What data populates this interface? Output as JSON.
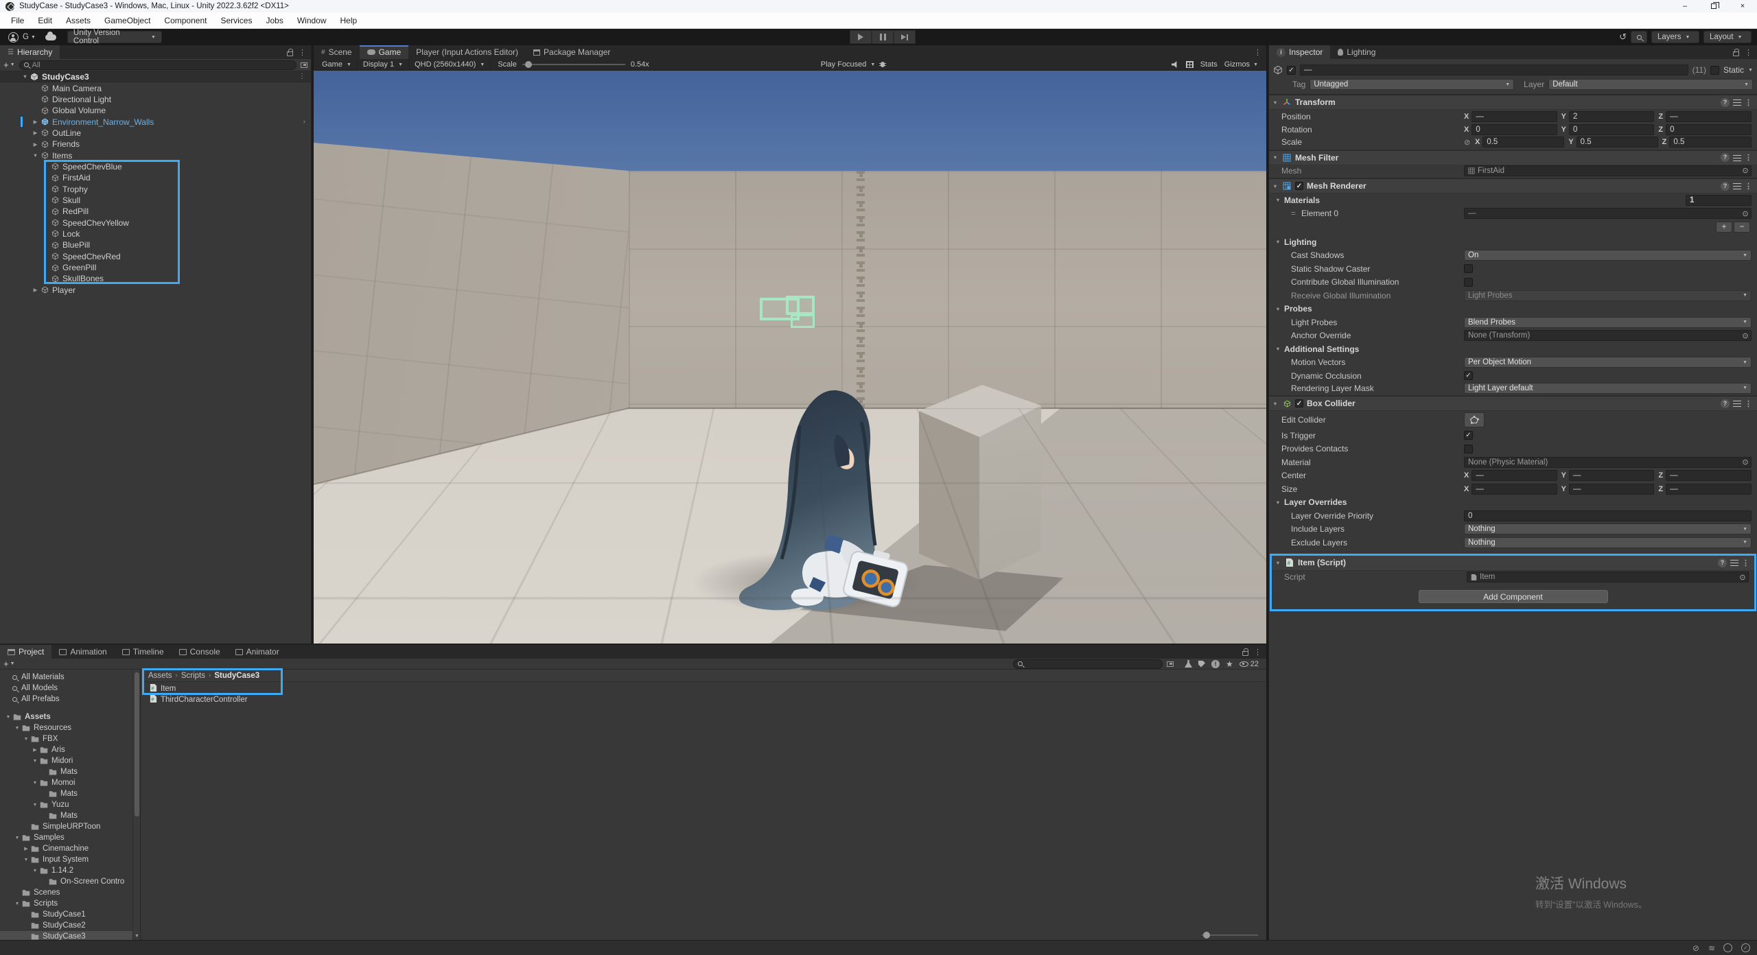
{
  "accents": {
    "highlight_blue": "#3fa9f5",
    "prefab_blue": "#6eb2e6",
    "tab_focus_blue": "#4f7fd0",
    "collider_green": "#8ee04a"
  },
  "title_bar": {
    "title": "StudyCase - StudyCase3 - Windows, Mac, Linux - Unity 2022.3.62f2 <DX11>"
  },
  "menu_bar": {
    "items": [
      "File",
      "Edit",
      "Assets",
      "GameObject",
      "Component",
      "Services",
      "Jobs",
      "Window",
      "Help"
    ]
  },
  "toolbar": {
    "account_label": "G",
    "version_control_label": "Unity Version Control",
    "layers_label": "Layers",
    "layout_label": "Layout"
  },
  "hierarchy": {
    "tab": "Hierarchy",
    "search_placeholder": "All",
    "rows": [
      {
        "label": "StudyCase3",
        "depth": 0,
        "icon": "scene",
        "arrow": "open",
        "header": true,
        "kebab": true
      },
      {
        "label": "Main Camera",
        "depth": 1,
        "icon": "cube"
      },
      {
        "label": "Directional Light",
        "depth": 1,
        "icon": "cube"
      },
      {
        "label": "Global Volume",
        "depth": 1,
        "icon": "cube"
      },
      {
        "label": "Environment_Narrow_Walls",
        "depth": 1,
        "icon": "prefab",
        "arrow": "closed",
        "prefab": true,
        "chevron": true,
        "bar": true
      },
      {
        "label": "OutLine",
        "depth": 1,
        "icon": "cube",
        "arrow": "closed"
      },
      {
        "label": "Friends",
        "depth": 1,
        "icon": "cube",
        "arrow": "closed"
      },
      {
        "label": "Items",
        "depth": 1,
        "icon": "cube",
        "arrow": "open"
      },
      {
        "label": "SpeedChevBlue",
        "depth": 2,
        "icon": "cube"
      },
      {
        "label": "FirstAid",
        "depth": 2,
        "icon": "cube"
      },
      {
        "label": "Trophy",
        "depth": 2,
        "icon": "cube"
      },
      {
        "label": "Skull",
        "depth": 2,
        "icon": "cube"
      },
      {
        "label": "RedPill",
        "depth": 2,
        "icon": "cube"
      },
      {
        "label": "SpeedChevYellow",
        "depth": 2,
        "icon": "cube"
      },
      {
        "label": "Lock",
        "depth": 2,
        "icon": "cube"
      },
      {
        "label": "BluePill",
        "depth": 2,
        "icon": "cube"
      },
      {
        "label": "SpeedChevRed",
        "depth": 2,
        "icon": "cube"
      },
      {
        "label": "GreenPill",
        "depth": 2,
        "icon": "cube"
      },
      {
        "label": "SkullBones",
        "depth": 2,
        "icon": "cube"
      },
      {
        "label": "Player",
        "depth": 1,
        "icon": "cube",
        "arrow": "closed"
      }
    ]
  },
  "center_tabs": {
    "scene": "Scene",
    "game": "Game",
    "player": "Player (Input Actions Editor)",
    "package": "Package Manager"
  },
  "game_toolbar": {
    "mode": "Game",
    "display": "Display 1",
    "resolution": "QHD (2560x1440)",
    "scale_label": "Scale",
    "scale_value": "0.54x",
    "play_focused": "Play Focused",
    "stats_label": "Stats",
    "gizmos_label": "Gizmos"
  },
  "inspector": {
    "tabs": [
      "Inspector",
      "Lighting"
    ],
    "header": {
      "name": "—",
      "count": "(11)",
      "static_label": "Static",
      "tag_label": "Tag",
      "tag_value": "Untagged",
      "layer_label": "Layer",
      "layer_value": "Default"
    },
    "transform": {
      "title": "Transform",
      "position": {
        "label": "Position",
        "x": "—",
        "y": "2",
        "z": "—"
      },
      "rotation": {
        "label": "Rotation",
        "x": "0",
        "y": "0",
        "z": "0"
      },
      "scale": {
        "label": "Scale",
        "x": "0.5",
        "y": "0.5",
        "z": "0.5"
      }
    },
    "mesh_filter": {
      "title": "Mesh Filter",
      "mesh_label": "Mesh",
      "mesh_value": "FirstAid"
    },
    "mesh_renderer": {
      "title": "Mesh Renderer",
      "materials_label": "Materials",
      "materials_count": "1",
      "element0_label": "Element 0",
      "element0_value": "—",
      "lighting_title": "Lighting",
      "cast_shadows_label": "Cast Shadows",
      "cast_shadows_value": "On",
      "static_shadow_label": "Static Shadow Caster",
      "contribute_gi_label": "Contribute Global Illumination",
      "receive_gi_label": "Receive Global Illumination",
      "receive_gi_value": "Light Probes",
      "probes_title": "Probes",
      "light_probes_label": "Light Probes",
      "light_probes_value": "Blend Probes",
      "anchor_label": "Anchor Override",
      "anchor_value": "None (Transform)",
      "additional_title": "Additional Settings",
      "motion_label": "Motion Vectors",
      "motion_value": "Per Object Motion",
      "occlusion_label": "Dynamic Occlusion",
      "mask_label": "Rendering Layer Mask",
      "mask_value": "Light Layer default"
    },
    "box_collider": {
      "title": "Box Collider",
      "edit_label": "Edit Collider",
      "trigger_label": "Is Trigger",
      "contacts_label": "Provides Contacts",
      "material_label": "Material",
      "material_value": "None (Physic Material)",
      "center_label": "Center",
      "center": {
        "x": "—",
        "y": "—",
        "z": "—"
      },
      "size_label": "Size",
      "size": {
        "x": "—",
        "y": "—",
        "z": "—"
      },
      "overrides_title": "Layer Overrides",
      "priority_label": "Layer Override Priority",
      "priority_value": "0",
      "include_label": "Include Layers",
      "include_value": "Nothing",
      "exclude_label": "Exclude Layers",
      "exclude_value": "Nothing"
    },
    "item_script": {
      "title": "Item (Script)",
      "script_label": "Script",
      "script_value": "Item"
    },
    "add_component_label": "Add Component"
  },
  "project": {
    "tabs": [
      "Project",
      "Animation",
      "Timeline",
      "Console",
      "Animator"
    ],
    "favorites": [
      "All Materials",
      "All Models",
      "All Prefabs"
    ],
    "tree": [
      {
        "label": "Assets",
        "depth": 0,
        "arrow": "open",
        "bold": true
      },
      {
        "label": "Resources",
        "depth": 1,
        "arrow": "open"
      },
      {
        "label": "FBX",
        "depth": 2,
        "arrow": "open"
      },
      {
        "label": "Aris",
        "depth": 3,
        "arrow": "closed"
      },
      {
        "label": "Midori",
        "depth": 3,
        "arrow": "open"
      },
      {
        "label": "Mats",
        "depth": 4
      },
      {
        "label": "Momoi",
        "depth": 3,
        "arrow": "open"
      },
      {
        "label": "Mats",
        "depth": 4
      },
      {
        "label": "Yuzu",
        "depth": 3,
        "arrow": "open"
      },
      {
        "label": "Mats",
        "depth": 4
      },
      {
        "label": "SimpleURPToon",
        "depth": 2
      },
      {
        "label": "Samples",
        "depth": 1,
        "arrow": "open"
      },
      {
        "label": "Cinemachine",
        "depth": 2,
        "arrow": "closed"
      },
      {
        "label": "Input System",
        "depth": 2,
        "arrow": "open"
      },
      {
        "label": "1.14.2",
        "depth": 3,
        "arrow": "open"
      },
      {
        "label": "On-Screen Contro",
        "depth": 4
      },
      {
        "label": "Scenes",
        "depth": 1
      },
      {
        "label": "Scripts",
        "depth": 1,
        "arrow": "open"
      },
      {
        "label": "StudyCase1",
        "depth": 2
      },
      {
        "label": "StudyCase2",
        "depth": 2
      },
      {
        "label": "StudyCase3",
        "depth": 2,
        "selected": true
      }
    ],
    "breadcrumb": [
      "Assets",
      "Scripts",
      "StudyCase3"
    ],
    "files": [
      {
        "label": "Item"
      },
      {
        "label": "ThirdCharacterController"
      }
    ],
    "eye_count": "22"
  },
  "watermark": {
    "line1": "激活 Windows",
    "line2": "转到“设置”以激活 Windows。"
  }
}
